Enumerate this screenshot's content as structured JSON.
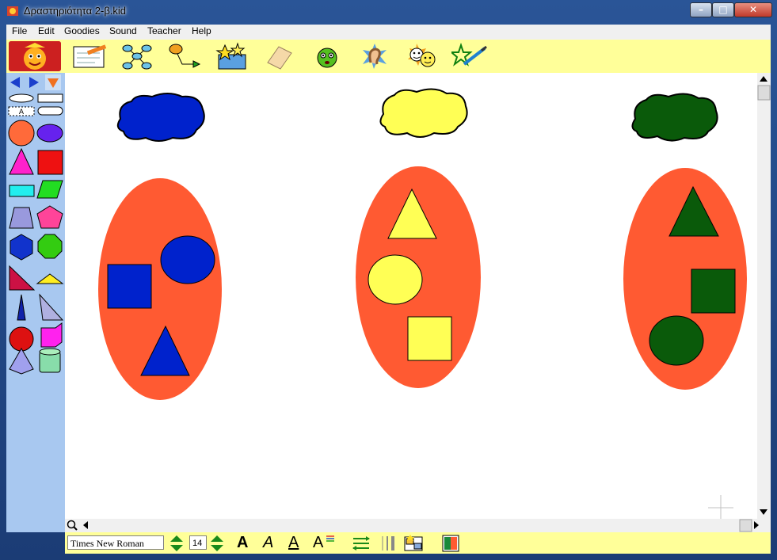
{
  "window": {
    "title": "Δραστηριότητα 2-β.kid"
  },
  "menu": [
    {
      "label": "File"
    },
    {
      "label": "Edit"
    },
    {
      "label": "Goodies"
    },
    {
      "label": "Sound"
    },
    {
      "label": "Teacher"
    },
    {
      "label": "Help"
    }
  ],
  "toolbar": {
    "tools": [
      "logo-icon",
      "writing-pad-icon",
      "concept-map-icon",
      "path-arrow-icon",
      "goodies-box-icon",
      "eraser-icon",
      "face-icon",
      "ear-icon",
      "faces-icon",
      "magic-wand-icon"
    ]
  },
  "palette": {
    "nav": [
      "arrow-left-icon",
      "arrow-right-icon",
      "dropdown-triangle-icon"
    ],
    "shapes": [
      "ellipse-outline",
      "rectangle-outline",
      "text-box",
      "rounded-rect-outline",
      "circle",
      "ellipse",
      "triangle",
      "square",
      "rectangle",
      "parallelogram",
      "trapezoid",
      "pentagon",
      "hexagon",
      "octagon",
      "right-triangle",
      "flat-triangle",
      "tall-triangle",
      "slanted-triangle",
      "sphere",
      "cube",
      "pyramid",
      "cylinder"
    ]
  },
  "colors": {
    "blue": "#0022cc",
    "yellow": "#ffff55",
    "green": "#0a5a0a",
    "orange": "#ff5a32",
    "panel": "#a8c8f0",
    "toolbar": "#ffff99"
  },
  "status": {
    "font_name": "Times New Roman",
    "font_size": "14",
    "bold": "A",
    "italic": "A",
    "underline": "A",
    "style": "A"
  }
}
